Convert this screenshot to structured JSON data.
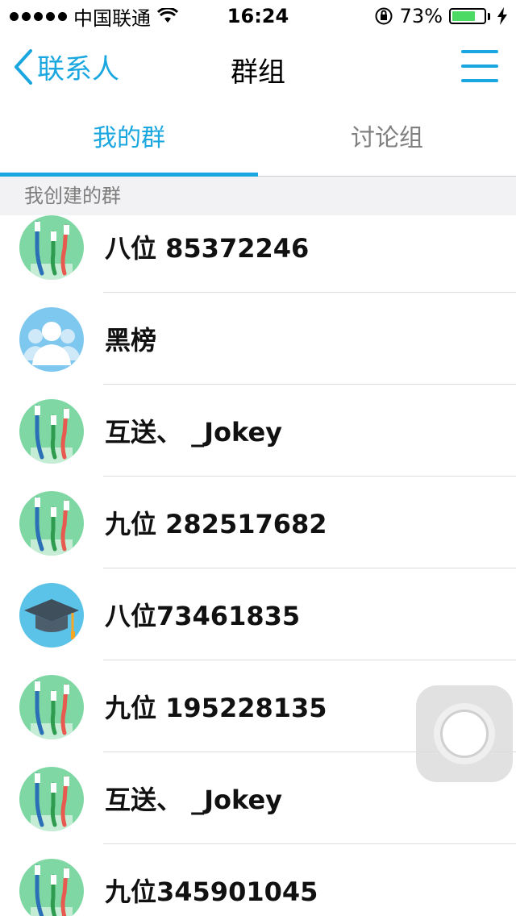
{
  "status_bar": {
    "carrier": "中国联通",
    "time": "16:24",
    "battery_percent": "73%",
    "battery_level": 0.73,
    "battery_color": "#4cd964"
  },
  "nav": {
    "back_label": "联系人",
    "title": "群组",
    "menu_icon": "hamburger-menu-icon",
    "accent_color": "#1aa7e0"
  },
  "tabs": [
    {
      "label": "我的群",
      "active": true
    },
    {
      "label": "讨论组",
      "active": false
    }
  ],
  "section": {
    "header": "我创建的群"
  },
  "groups": [
    {
      "name": "八位 85372246",
      "avatar": "toothbrush-icon"
    },
    {
      "name": "黑榜",
      "avatar": "people-icon"
    },
    {
      "name": "互送、 _Jokey",
      "avatar": "toothbrush-icon"
    },
    {
      "name": "九位 282517682",
      "avatar": "toothbrush-icon"
    },
    {
      "name": "八位73461835",
      "avatar": "graduation-cap-icon"
    },
    {
      "name": "九位 195228135",
      "avatar": "toothbrush-icon"
    },
    {
      "name": "互送、 _Jokey",
      "avatar": "toothbrush-icon"
    },
    {
      "name": "九位345901045",
      "avatar": "toothbrush-icon"
    }
  ]
}
